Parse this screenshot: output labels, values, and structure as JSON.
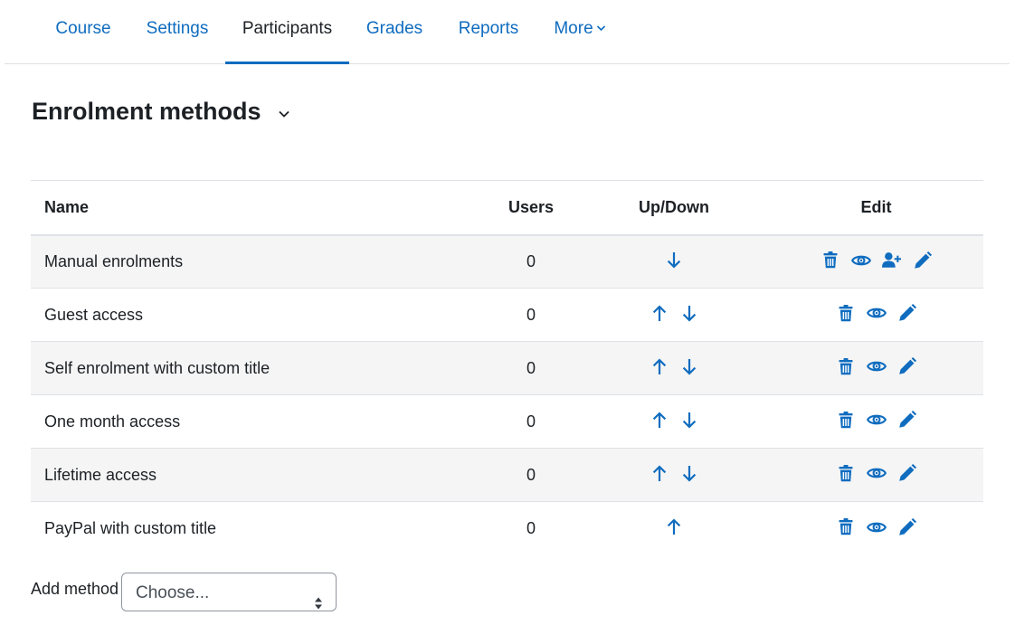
{
  "nav": {
    "tabs": [
      {
        "label": "Course"
      },
      {
        "label": "Settings"
      },
      {
        "label": "Participants",
        "active": true
      },
      {
        "label": "Grades"
      },
      {
        "label": "Reports"
      },
      {
        "label": "More"
      }
    ]
  },
  "page": {
    "title": "Enrolment methods"
  },
  "table": {
    "headers": {
      "name": "Name",
      "users": "Users",
      "updown": "Up/Down",
      "edit": "Edit"
    },
    "rows": [
      {
        "name": "Manual enrolments",
        "users": "0",
        "up": false,
        "down": true,
        "icons": [
          "trash-icon",
          "eye-icon",
          "user-plus-icon",
          "pencil-icon"
        ]
      },
      {
        "name": "Guest access",
        "users": "0",
        "up": true,
        "down": true,
        "icons": [
          "trash-icon",
          "eye-icon",
          "pencil-icon"
        ]
      },
      {
        "name": "Self enrolment with custom title",
        "users": "0",
        "up": true,
        "down": true,
        "icons": [
          "trash-icon",
          "eye-icon",
          "pencil-icon"
        ]
      },
      {
        "name": "One month access",
        "users": "0",
        "up": true,
        "down": true,
        "icons": [
          "trash-icon",
          "eye-icon",
          "pencil-icon"
        ]
      },
      {
        "name": "Lifetime access",
        "users": "0",
        "up": true,
        "down": true,
        "icons": [
          "trash-icon",
          "eye-icon",
          "pencil-icon"
        ]
      },
      {
        "name": "PayPal with custom title",
        "users": "0",
        "up": true,
        "down": false,
        "icons": [
          "trash-icon",
          "eye-icon",
          "pencil-icon"
        ]
      }
    ]
  },
  "add_method": {
    "label": "Add method",
    "select_value": "Choose..."
  },
  "colors": {
    "link": "#0f6cbf",
    "text": "#1d2125",
    "stripe": "#f5f5f5",
    "border": "#dee2e6"
  }
}
